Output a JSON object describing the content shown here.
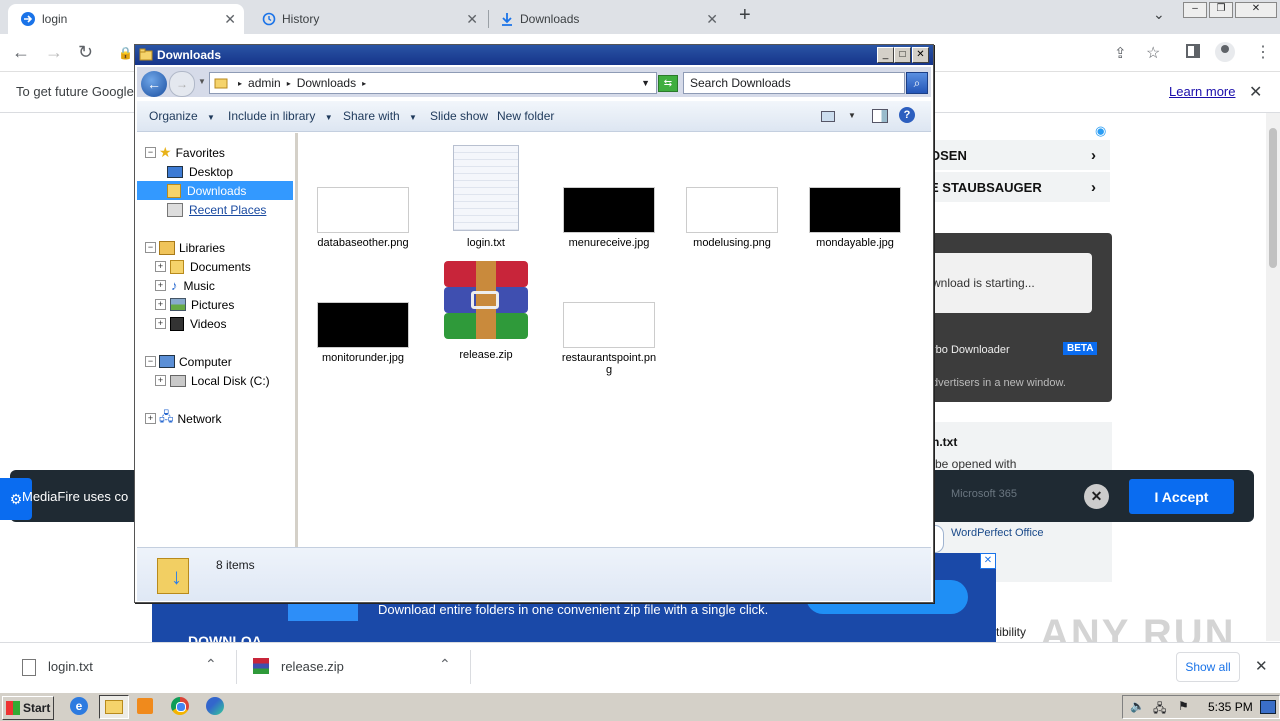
{
  "browser": {
    "tabs": [
      {
        "label": "login",
        "icon": "login-favicon"
      },
      {
        "label": "History",
        "icon": "history-icon"
      },
      {
        "label": "Downloads",
        "icon": "download-icon"
      }
    ],
    "new_tab": "+",
    "infobar_text": "To get future Google",
    "learn_more": "Learn more"
  },
  "page": {
    "rows": [
      "OSEN",
      "E STAUBSAUGER"
    ],
    "download_starting": "wnload is starting...",
    "turbo_downloader": "rbo Downloader",
    "beta": "BETA",
    "advertisers": "dvertisers in a new window.",
    "file_name": "n.txt",
    "opened_with": "be opened with",
    "microsoft": "Microsoft 365",
    "wordperfect": "WordPerfect Office",
    "cookie_text": "MediaFire uses co",
    "accept": "I Accept",
    "banner_text": "Download entire folders in one convenient zip file with a single click.",
    "banner_heading": "DOWNLOA",
    "compat": "tibility",
    "watermark": "ANY RUN"
  },
  "explorer": {
    "title": "Downloads",
    "breadcrumb": [
      "admin",
      "Downloads"
    ],
    "search_placeholder": "Search Downloads",
    "commands": [
      "Organize",
      "Include in library",
      "Share with",
      "Slide show",
      "New folder"
    ],
    "nav": {
      "favorites": "Favorites",
      "favorites_items": [
        "Desktop",
        "Downloads",
        "Recent Places"
      ],
      "libraries": "Libraries",
      "libraries_items": [
        "Documents",
        "Music",
        "Pictures",
        "Videos"
      ],
      "computer": "Computer",
      "computer_items": [
        "Local Disk (C:)"
      ],
      "network": "Network"
    },
    "files": [
      {
        "name": "databaseother.png",
        "thumb": "white"
      },
      {
        "name": "login.txt",
        "thumb": "text"
      },
      {
        "name": "menureceive.jpg",
        "thumb": "black"
      },
      {
        "name": "modelusing.png",
        "thumb": "white"
      },
      {
        "name": "mondayable.jpg",
        "thumb": "black"
      },
      {
        "name": "monitorunder.jpg",
        "thumb": "black"
      },
      {
        "name": "release.zip",
        "thumb": "winrar"
      },
      {
        "name": "restaurantspoint.png",
        "thumb": "white"
      }
    ],
    "item_count": "8 items"
  },
  "shelf": {
    "items": [
      {
        "name": "login.txt"
      },
      {
        "name": "release.zip"
      }
    ],
    "show_all": "Show all"
  },
  "taskbar": {
    "start": "Start",
    "time": "5:35 PM"
  },
  "colors": {
    "accent": "#0a6cf0",
    "title_bar": "#1f3f96",
    "taskbar": "#d4d0c8"
  }
}
